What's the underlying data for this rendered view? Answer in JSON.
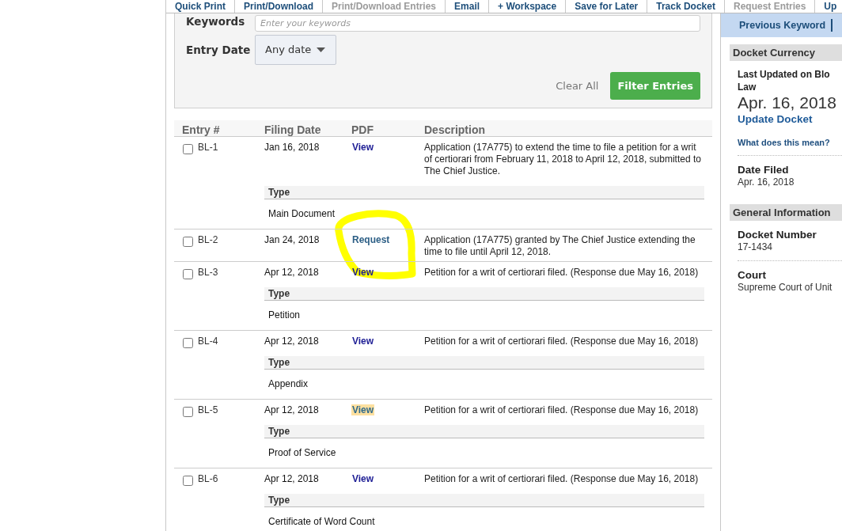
{
  "toolbar": {
    "tabs": [
      {
        "label": "Quick Print",
        "disabled": false
      },
      {
        "label": "Print/Download",
        "disabled": false
      },
      {
        "label": "Print/Download Entries",
        "disabled": true
      },
      {
        "label": "Email",
        "disabled": false
      },
      {
        "label": "+ Workspace",
        "disabled": false
      },
      {
        "label": "Save for Later",
        "disabled": false
      },
      {
        "label": "Track Docket",
        "disabled": false
      },
      {
        "label": "Request Entries",
        "disabled": true
      },
      {
        "label": "Up",
        "disabled": false
      }
    ]
  },
  "filter": {
    "keywords": {
      "label": "Keywords",
      "placeholder": "Enter your keywords"
    },
    "entry_date": {
      "label": "Entry Date",
      "value": "Any date"
    },
    "clear_button": "Clear All",
    "filter_button": "Filter Entries"
  },
  "entries": {
    "columns": [
      "Entry #",
      "Filing Date",
      "PDF",
      "Description"
    ],
    "rows": [
      {
        "entry": "BL-1",
        "checked": false,
        "filing_date": "Jan 16, 2018",
        "pdf": {
          "label": "View",
          "kind": "view",
          "highlighted": false
        },
        "description": "Application (17A775) to extend the time to file a petition for a writ of certiorari from February 11, 2018 to April 12, 2018, submitted to The Chief Justice.",
        "type_heading": "Type",
        "type": "Main Document"
      },
      {
        "entry": "BL-2",
        "checked": false,
        "filing_date": "Jan 24, 2018",
        "pdf": {
          "label": "Request",
          "kind": "request",
          "highlighted": false
        },
        "description": "Application (17A775) granted by The Chief Justice extending the time to file until April 12, 2018."
      },
      {
        "entry": "BL-3",
        "checked": false,
        "filing_date": "Apr 12, 2018",
        "pdf": {
          "label": "View",
          "kind": "view",
          "highlighted": false
        },
        "description": "Petition for a writ of certiorari filed. (Response due May 16, 2018)",
        "type_heading": "Type",
        "type": "Petition"
      },
      {
        "entry": "BL-4",
        "checked": false,
        "filing_date": "Apr 12, 2018",
        "pdf": {
          "label": "View",
          "kind": "view",
          "highlighted": false
        },
        "description": "Petition for a writ of certiorari filed. (Response due May 16, 2018)",
        "type_heading": "Type",
        "type": "Appendix"
      },
      {
        "entry": "BL-5",
        "checked": false,
        "filing_date": "Apr 12, 2018",
        "pdf": {
          "label": "View",
          "kind": "view",
          "highlighted": true
        },
        "description": "Petition for a writ of certiorari filed. (Response due May 16, 2018)",
        "type_heading": "Type",
        "type": "Proof of Service"
      },
      {
        "entry": "BL-6",
        "checked": false,
        "filing_date": "Apr 12, 2018",
        "pdf": {
          "label": "View",
          "kind": "view",
          "highlighted": false
        },
        "description": "Petition for a writ of certiorari filed. (Response due May 16, 2018)",
        "type_heading": "Type",
        "type": "Certificate of Word Count"
      }
    ]
  },
  "sidebar": {
    "previous_link": "Previous Keyword",
    "sections": [
      {
        "title": "Docket Currency",
        "items": [
          {
            "kind": "update",
            "label": "Last Updated on Blo\nLaw",
            "value": "Apr. 16, 2018",
            "link": "Update Docket",
            "help": "What does this mean?"
          },
          {
            "kind": "field",
            "label": "Date Filed",
            "value": "Apr. 16, 2018"
          }
        ]
      },
      {
        "title": "General Information",
        "items": [
          {
            "kind": "field",
            "label": "Docket Number",
            "value": "17-1434"
          },
          {
            "kind": "field",
            "label": "Court",
            "value": "Supreme Court of Unit"
          }
        ]
      }
    ]
  }
}
